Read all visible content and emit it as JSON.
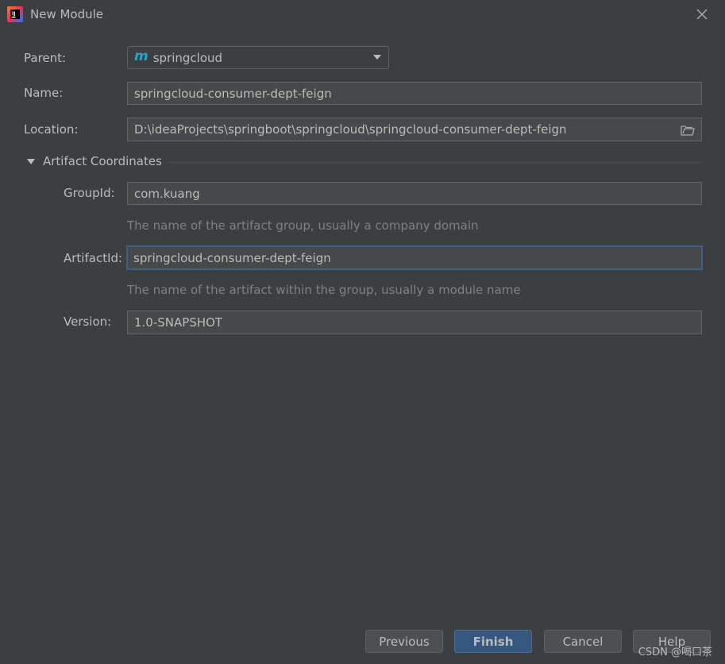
{
  "window": {
    "title": "New Module",
    "app_icon": "intellij-idea-icon"
  },
  "form": {
    "parent": {
      "label": "Parent:",
      "value": "springcloud",
      "icon": "maven-icon",
      "icon_glyph": "m"
    },
    "name": {
      "label": "Name:",
      "value": "springcloud-consumer-dept-feign"
    },
    "location": {
      "label": "Location:",
      "value": "D:\\ideaProjects\\springboot\\springcloud\\springcloud-consumer-dept-feign"
    }
  },
  "artifact": {
    "section_title": "Artifact Coordinates",
    "group_id": {
      "label": "GroupId:",
      "value": "com.kuang",
      "hint": "The name of the artifact group, usually a company domain"
    },
    "artifact_id": {
      "label": "ArtifactId:",
      "value": "springcloud-consumer-dept-feign",
      "hint": "The name of the artifact within the group, usually a module name"
    },
    "version": {
      "label": "Version:",
      "value": "1.0-SNAPSHOT"
    }
  },
  "buttons": {
    "previous": "Previous",
    "finish": "Finish",
    "cancel": "Cancel",
    "help": "Help"
  },
  "watermark": "CSDN @喝口茶",
  "colors": {
    "background": "#3c3f41",
    "field_bg": "#45494a",
    "primary_button": "#365880",
    "focus_border": "#3d6185",
    "maven_icon": "#2da4c6"
  }
}
